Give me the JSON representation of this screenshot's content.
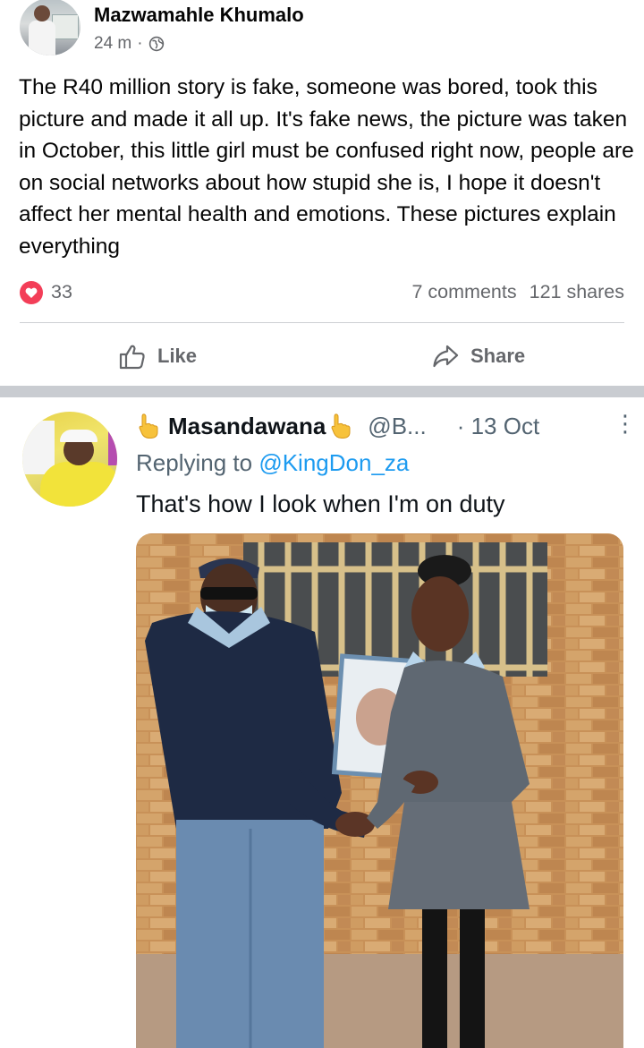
{
  "post": {
    "author": "Mazwamahle Khumalo",
    "time": "24 m",
    "dot": "·",
    "privacy_icon": "globe-icon",
    "text": "The R40 million story is fake, someone was bored, took this picture and made it all up. It's fake news, the picture was taken in October, this little girl must be confused right now, people are on social networks about how stupid she is, I hope it doesn't affect her mental health and emotions. These pictures explain everything",
    "reactions_count": "33",
    "comments": "7 comments",
    "shares": "121 shares",
    "like_label": "Like",
    "share_label": "Share"
  },
  "tweet": {
    "name": "Masandawana",
    "handle": "@B...",
    "date": "· 13 Oct",
    "more": "⋮",
    "reply_prefix": "Replying to ",
    "reply_to": "@KingDon_za",
    "text": "That's how I look when I'm on duty"
  },
  "colors": {
    "heart": "#f33e58",
    "fb_gray": "#65676b",
    "twitter_blue": "#1d9bf0",
    "twitter_gray": "#536471",
    "police_navy": "#1e2a44",
    "school_gray": "#5f6872"
  }
}
